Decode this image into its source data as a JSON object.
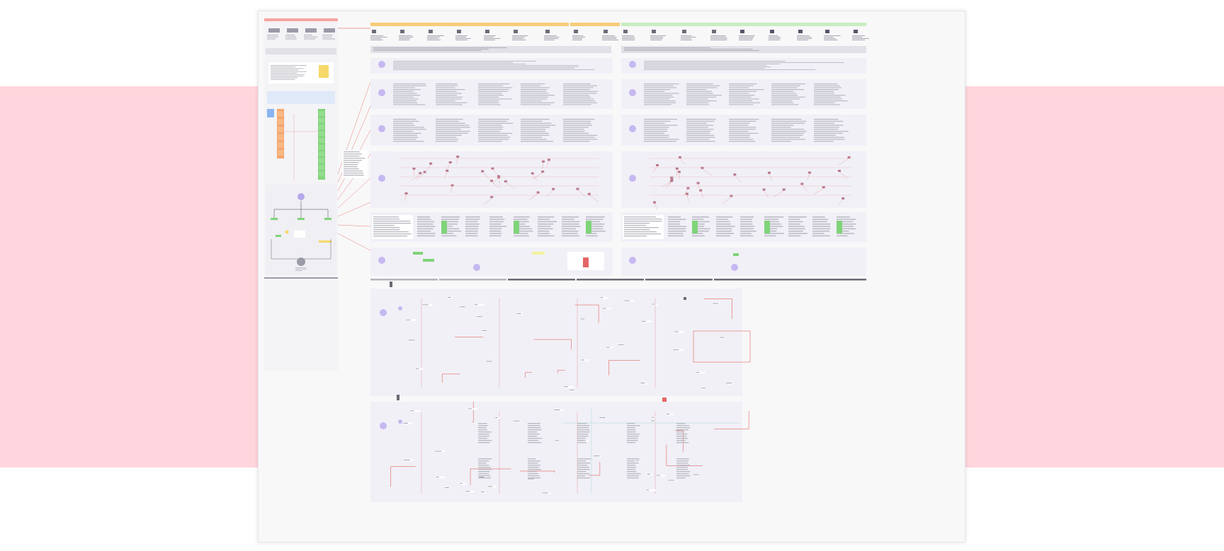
{
  "colors": {
    "page_background": "#ffffff",
    "band": "#ffd6dd",
    "canvas": "#f8f8f9",
    "section_bg": "#f1f0f7",
    "stage_red": "#f7a4a0",
    "stage_orange": "#f8cc7a",
    "stage_green": "#c9edc2",
    "accent_purple": "#8d76d8",
    "accent_red": "#e0473b",
    "sticky_yellow": "#f6d96a",
    "sticky_blue": "#8ab4f0",
    "sticky_orange": "#f5a56a",
    "sticky_green": "#7fd479"
  },
  "left_panel": {
    "header": "",
    "sections": [
      {
        "title": ""
      },
      {
        "title": ""
      }
    ]
  },
  "stages": [
    {
      "label": ""
    },
    {
      "label": ""
    },
    {
      "label": ""
    },
    {
      "label": ""
    }
  ],
  "top_title": "",
  "section_titles": [
    "",
    "",
    "",
    "",
    "",
    "",
    "",
    ""
  ],
  "flow_titles": [
    "",
    ""
  ],
  "icons": {
    "persona": "persona-icon",
    "goals": "target-icon",
    "pains": "warning-icon",
    "journey": "journey-icon",
    "user": "user-icon"
  }
}
